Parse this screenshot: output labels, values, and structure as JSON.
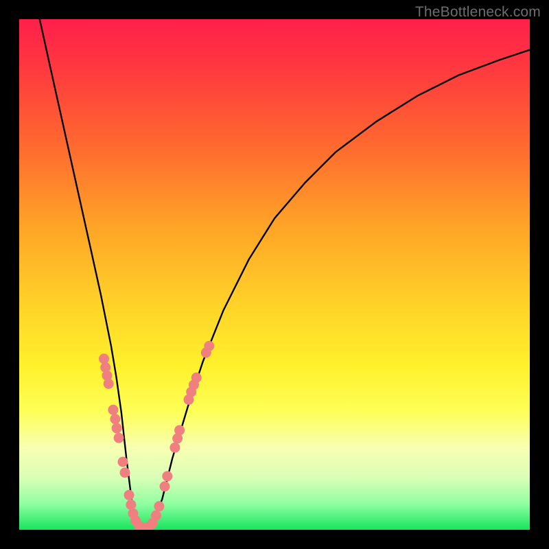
{
  "watermark": "TheBottleneck.com",
  "chart_data": {
    "type": "line",
    "title": "",
    "xlabel": "",
    "ylabel": "",
    "xlim": [
      0,
      100
    ],
    "ylim": [
      0,
      100
    ],
    "series": [
      {
        "name": "bottleneck-curve",
        "x": [
          4,
          6,
          8,
          10,
          12,
          14,
          16,
          18,
          19,
          20,
          21,
          22,
          23,
          24,
          25,
          26,
          28,
          30,
          33,
          36,
          40,
          45,
          50,
          56,
          62,
          70,
          78,
          86,
          94,
          100
        ],
        "y": [
          100,
          91,
          82,
          73,
          64,
          55,
          46,
          36,
          30,
          23,
          14,
          6,
          1,
          0,
          0,
          1,
          6,
          14,
          24,
          33,
          43,
          53,
          61,
          68,
          74,
          80,
          85,
          89,
          92,
          94
        ]
      }
    ],
    "markers": {
      "name": "highlight-dots",
      "color": "#f08080",
      "points": [
        {
          "x_pct": 16.6,
          "y_pct_from_top": 66.5
        },
        {
          "x_pct": 16.9,
          "y_pct_from_top": 68.2
        },
        {
          "x_pct": 17.2,
          "y_pct_from_top": 69.8
        },
        {
          "x_pct": 17.5,
          "y_pct_from_top": 71.4
        },
        {
          "x_pct": 18.4,
          "y_pct_from_top": 76.5
        },
        {
          "x_pct": 18.8,
          "y_pct_from_top": 78.3
        },
        {
          "x_pct": 19.1,
          "y_pct_from_top": 80.1
        },
        {
          "x_pct": 19.5,
          "y_pct_from_top": 82.0
        },
        {
          "x_pct": 20.3,
          "y_pct_from_top": 86.7
        },
        {
          "x_pct": 20.7,
          "y_pct_from_top": 88.8
        },
        {
          "x_pct": 21.5,
          "y_pct_from_top": 93.2
        },
        {
          "x_pct": 21.9,
          "y_pct_from_top": 95.1
        },
        {
          "x_pct": 22.3,
          "y_pct_from_top": 96.8
        },
        {
          "x_pct": 22.8,
          "y_pct_from_top": 98.2
        },
        {
          "x_pct": 23.5,
          "y_pct_from_top": 99.3
        },
        {
          "x_pct": 24.4,
          "y_pct_from_top": 99.6
        },
        {
          "x_pct": 25.3,
          "y_pct_from_top": 99.5
        },
        {
          "x_pct": 26.1,
          "y_pct_from_top": 98.7
        },
        {
          "x_pct": 26.8,
          "y_pct_from_top": 97.2
        },
        {
          "x_pct": 27.4,
          "y_pct_from_top": 95.4
        },
        {
          "x_pct": 28.5,
          "y_pct_from_top": 91.5
        },
        {
          "x_pct": 29.0,
          "y_pct_from_top": 89.5
        },
        {
          "x_pct": 30.5,
          "y_pct_from_top": 83.9
        },
        {
          "x_pct": 31.0,
          "y_pct_from_top": 82.1
        },
        {
          "x_pct": 31.4,
          "y_pct_from_top": 80.5
        },
        {
          "x_pct": 33.2,
          "y_pct_from_top": 74.5
        },
        {
          "x_pct": 33.7,
          "y_pct_from_top": 73.0
        },
        {
          "x_pct": 34.2,
          "y_pct_from_top": 71.6
        },
        {
          "x_pct": 34.7,
          "y_pct_from_top": 70.2
        },
        {
          "x_pct": 36.6,
          "y_pct_from_top": 65.3
        },
        {
          "x_pct": 37.2,
          "y_pct_from_top": 64.0
        }
      ]
    }
  }
}
